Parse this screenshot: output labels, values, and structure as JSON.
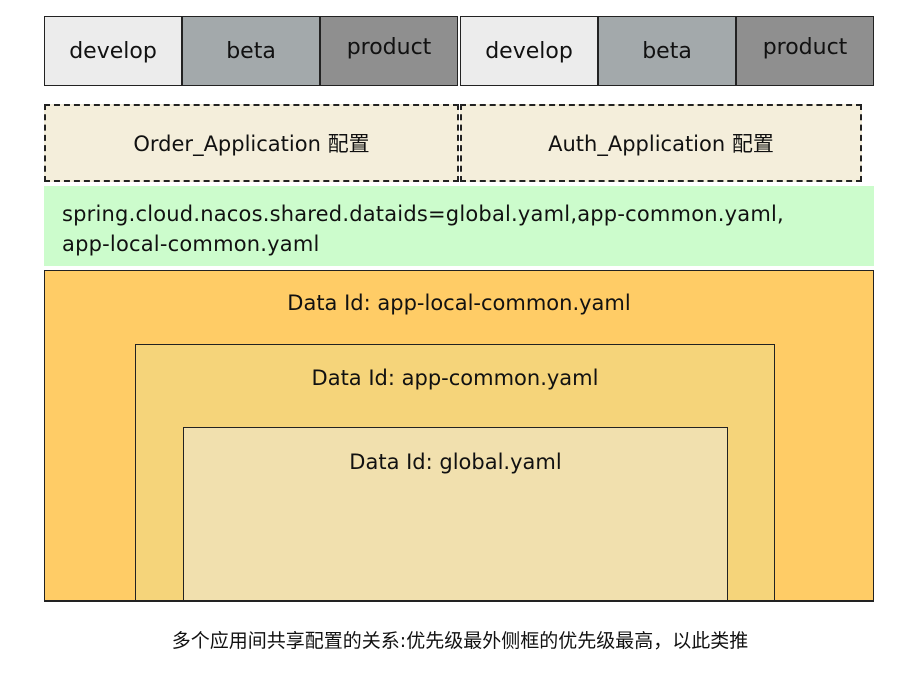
{
  "env_groups": [
    {
      "develop": "develop",
      "beta": "beta",
      "product": "product"
    },
    {
      "develop": "develop",
      "beta": "beta",
      "product": "product"
    }
  ],
  "apps": {
    "order": "Order_Application 配置",
    "auth": "Auth_Application 配置"
  },
  "shared_config": {
    "line1": "spring.cloud.nacos.shared.dataids=global.yaml,app-common.yaml,",
    "line2": "app-local-common.yaml"
  },
  "layers": {
    "outer": "Data Id: app-local-common.yaml",
    "middle": "Data Id: app-common.yaml",
    "inner": "Data Id: global.yaml"
  },
  "colors": {
    "outer": "#ffcc66",
    "middle": "#f5d47a",
    "inner": "#f1e0ae",
    "shared": "#ccfccc",
    "app": "#f4eedb"
  },
  "caption": "多个应用间共享配置的关系:优先级最外侧框的优先级最高，以此类推"
}
